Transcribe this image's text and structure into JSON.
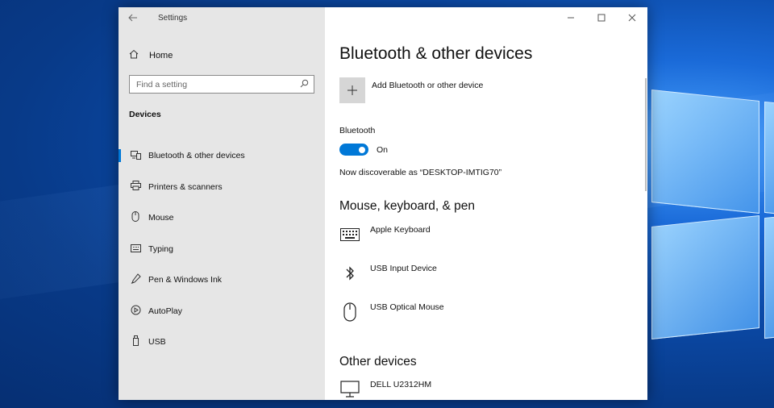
{
  "window": {
    "title": "Settings",
    "back_icon": "back-arrow-icon",
    "controls": {
      "minimize": "—",
      "maximize": "☐",
      "close": "✕"
    }
  },
  "sidebar": {
    "home_label": "Home",
    "search_placeholder": "Find a setting",
    "section_label": "Devices",
    "items": [
      {
        "label": "Bluetooth & other devices",
        "icon": "bluetooth-devices-icon",
        "active": true
      },
      {
        "label": "Printers & scanners",
        "icon": "printer-icon"
      },
      {
        "label": "Mouse",
        "icon": "mouse-icon"
      },
      {
        "label": "Typing",
        "icon": "keyboard-icon"
      },
      {
        "label": "Pen & Windows Ink",
        "icon": "pen-icon"
      },
      {
        "label": "AutoPlay",
        "icon": "autoplay-icon"
      },
      {
        "label": "USB",
        "icon": "usb-icon"
      }
    ]
  },
  "main": {
    "title": "Bluetooth & other devices",
    "add_device_label": "Add Bluetooth or other device",
    "bluetooth_label": "Bluetooth",
    "bluetooth_state": "On",
    "discoverable_text": "Now discoverable as “DESKTOP-IMTIG70”",
    "mouse_section_title": "Mouse, keyboard, & pen",
    "mouse_devices": [
      {
        "name": "Apple Keyboard",
        "icon": "keyboard-icon"
      },
      {
        "name": "USB Input Device",
        "icon": "bluetooth-icon"
      },
      {
        "name": "USB Optical Mouse",
        "icon": "mouse-icon"
      }
    ],
    "other_section_title": "Other devices",
    "other_devices": [
      {
        "name": "DELL U2312HM",
        "icon": "monitor-icon"
      }
    ]
  },
  "colors": {
    "accent": "#0078d7",
    "sidebar_bg": "#e6e6e6"
  }
}
